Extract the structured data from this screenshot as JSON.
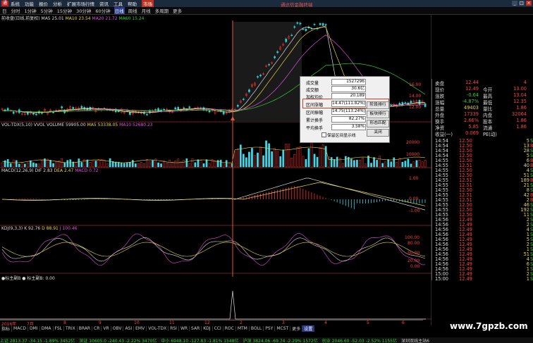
{
  "menu": {
    "items": [
      "系统",
      "功能",
      "报价",
      "分析",
      "扩展市场行情",
      "资讯",
      "工具",
      "帮助"
    ],
    "market_label": "市场",
    "window_title": "通达信金融终端"
  },
  "periods": {
    "items": [
      "日",
      "分时",
      "1分钟",
      "5分钟",
      "15分钟",
      "30分钟",
      "60分钟",
      "日线",
      "周线",
      "月线",
      "多周期",
      "更多"
    ],
    "active_index": 7
  },
  "panels": {
    "main": {
      "title": "前收盘(日线,前复权)",
      "ma5": "MA5 25.01",
      "ma10": "MA10 23.54",
      "ma20": "MA20 21.72",
      "ma60": "MA60 15.24"
    },
    "vol": {
      "title": "VOL-TDX(5,10) VVOL",
      "volume": "VOLUME 59905.00",
      "ma5": "MA5 53338.05",
      "ma10": "MA10 52680.23"
    },
    "macd": {
      "title": "MACD(12,26,9)",
      "dif": "DIF 2.83",
      "dea": "DEA 2.47",
      "macd": "MACD 0.72"
    },
    "kdj": {
      "title": "KDJ(9,3,3)",
      "k": "K 92.76",
      "d": "D 88.91",
      "j": "J 100.46"
    },
    "extra": {
      "title": "●标主副B ● 标主副B: 0.00"
    }
  },
  "axis": {
    "main_right": [
      "16.00",
      "14.00",
      "12.00"
    ],
    "vol_right": [
      "20000",
      "10000"
    ],
    "macd_right": [
      "1.00",
      "0.00",
      "-1.00"
    ],
    "kdj_right": [
      "100.00",
      "80.00",
      "50.00",
      "20.00",
      "0.00"
    ],
    "time_labels": [
      "2016年",
      "7月",
      "8",
      "9",
      "10",
      "11",
      "12",
      "2",
      "3",
      "4",
      "5",
      "6"
    ]
  },
  "dialog": {
    "rows": [
      {
        "label": "成交量",
        "value": "1527296"
      },
      {
        "label": "成交额",
        "value": "30.6亿"
      },
      {
        "label": "加权均价",
        "value": "20.189"
      },
      {
        "label": "区间涨幅",
        "value": "14.47(111.82%)"
      },
      {
        "label": "区间振幅",
        "value": "14.75(113.24%)"
      },
      {
        "label": "累计换手",
        "value": "82.27%"
      },
      {
        "label": "平均换手",
        "value": "3.58%"
      }
    ],
    "buttons": [
      "阶段排行",
      "板块排行",
      "形态匹配",
      "关闭"
    ],
    "checkbox_label": "保留区间显示线"
  },
  "quote": {
    "rows": [
      {
        "l1": "卖盘",
        "v1": "12.44",
        "l2": "",
        "v2": "4"
      },
      {
        "l1": "现价",
        "v1": "12.49",
        "l2": "今开",
        "v2": "13.00"
      },
      {
        "l1": "涨跌",
        "v1": "-0.64",
        "l2": "最高",
        "v2": "13.04"
      },
      {
        "l1": "涨幅",
        "v1": "-4.87%",
        "l2": "最低",
        "v2": "12.35"
      },
      {
        "l1": "总量",
        "v1": "49403",
        "l2": "量比",
        "v2": "1.86"
      },
      {
        "l1": "外盘",
        "v1": "17339",
        "l2": "内盘",
        "v2": "32064"
      },
      {
        "l1": "换手",
        "v1": "2.66%",
        "l2": "股本",
        "v2": "1.86"
      },
      {
        "l1": "净资",
        "v1": "5.85",
        "l2": "流通",
        "v2": "1.86"
      },
      {
        "l1": "收益(一)",
        "v1": "0.069",
        "l2": "PE(动)",
        "v2": ""
      }
    ],
    "ticks": [
      {
        "t": "14:54",
        "p": "12.50",
        "v": "5",
        "s": "S"
      },
      {
        "t": "14:54",
        "p": "12.50",
        "v": "13",
        "s": "B"
      },
      {
        "t": "14:54",
        "p": "12.50",
        "v": "28",
        "s": "S"
      },
      {
        "t": "14:54",
        "p": "12.50",
        "v": "5",
        "s": "S"
      },
      {
        "t": "14:55",
        "p": "12.50",
        "v": "6",
        "s": "B"
      },
      {
        "t": "14:55",
        "p": "12.51",
        "v": "40",
        "s": "B"
      },
      {
        "t": "14:55",
        "p": "12.50",
        "v": "4",
        "s": "S"
      },
      {
        "t": "14:55",
        "p": "12.50",
        "v": "51",
        "s": "S"
      },
      {
        "t": "14:55",
        "p": "12.51",
        "v": "189",
        "s": "B"
      },
      {
        "t": "14:55",
        "p": "12.51",
        "v": "21",
        "s": "S"
      },
      {
        "t": "14:55",
        "p": "12.50",
        "v": "8",
        "s": "S"
      },
      {
        "t": "14:55",
        "p": "12.51",
        "v": "42",
        "s": "B"
      },
      {
        "t": "14:55",
        "p": "12.51",
        "v": "2",
        "s": "B"
      },
      {
        "t": "14:55",
        "p": "12.50",
        "v": "46",
        "s": "S"
      },
      {
        "t": "14:55",
        "p": "12.50",
        "v": "192",
        "s": "S"
      },
      {
        "t": "14:55",
        "p": "12.50",
        "v": "11",
        "s": "S"
      },
      {
        "t": "14:56",
        "p": "12.49",
        "v": "2",
        "s": "S"
      },
      {
        "t": "14:56",
        "p": "12.49",
        "v": "2",
        "s": "S"
      },
      {
        "t": "14:56",
        "p": "12.49",
        "v": "4",
        "s": "S"
      },
      {
        "t": "14:56",
        "p": "12.49",
        "v": "1",
        "s": "S"
      },
      {
        "t": "14:56",
        "p": "12.49",
        "v": "5",
        "s": "S"
      },
      {
        "t": "14:56",
        "p": "12.49",
        "v": "2",
        "s": "S"
      },
      {
        "t": "14:56",
        "p": "12.49",
        "v": "1",
        "s": "S"
      },
      {
        "t": "14:56",
        "p": "12.49",
        "v": "51",
        "s": "S"
      },
      {
        "t": "14:56",
        "p": "12.49",
        "v": "4",
        "s": "S"
      },
      {
        "t": "14:56",
        "p": "12.49",
        "v": "6",
        "s": "S"
      },
      {
        "t": "14:56",
        "p": "12.49",
        "v": "1",
        "s": "S"
      },
      {
        "t": "15:00",
        "p": "12.49",
        "v": "2",
        "s": "S"
      },
      {
        "t": "15:00",
        "p": "12.49",
        "v": "1",
        "s": "S"
      }
    ]
  },
  "indicator_tabs": {
    "items": [
      "指标",
      "MACD",
      "DMI",
      "DMA",
      "FSL",
      "TRIX",
      "BRAR",
      "CR",
      "VR",
      "OBV",
      "ASI",
      "EMV",
      "VOL-TDX",
      "RSI",
      "WR",
      "SAR",
      "KDJ",
      "CCI",
      "ROC",
      "MTM",
      "BOLL",
      "PSY",
      "MCST",
      "更多",
      "设置"
    ],
    "active_index": 24
  },
  "status": {
    "items": [
      "上证 2813.37 -34.15 -1.89% 3452亿",
      "深证 10605.0 -240.43 -2.22% 3470亿",
      "中小 6948.10 -127.83 -1.81% 1548亿",
      "沪深 3824.06 -69.74 -2.29% 1572亿",
      "创业 2046.60 -52.03 -2.52% 1155亿",
      "深圳双线主站6"
    ]
  },
  "watermark": "www.7gpzb.com"
}
